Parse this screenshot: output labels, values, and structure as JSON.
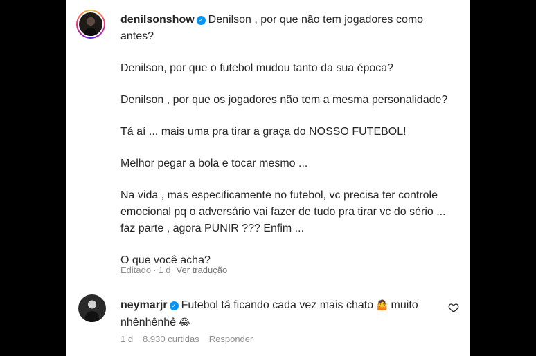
{
  "post": {
    "username": "denilsonshow",
    "paragraphs": [
      "Denilson , por que não tem jogadores como antes?",
      "Denilson, por que o futebol mudou tanto da sua época?",
      "Denilson , por que os jogadores não tem a mesma personalidade?",
      "Tá aí ... mais uma pra tirar a graça do NOSSO FUTEBOL!",
      "Melhor pegar a bola e tocar mesmo ...",
      "Na vida , mas especificamente no futebol, vc precisa ter controle emocional pq o adversário vai fazer de tudo pra tirar vc do sério ... faz parte , agora PUNIR ??? Enfim ...",
      "O que você acha?"
    ],
    "edited_label": "Editado",
    "separator": "·",
    "time_ago": "1 d",
    "translate_label": "Ver tradução"
  },
  "reply": {
    "username": "neymarjr",
    "text_before_emoji": "Futebol tá ficando cada vez mais chato",
    "emoji_1": "🤷",
    "text_after_emoji": "muito nhênhênhê",
    "emoji_2": "😂",
    "time_ago": "1 d",
    "likes": "8.930 curtidas",
    "reply_label": "Responder"
  },
  "icons": {
    "verified": "verified-badge-icon",
    "like": "heart-icon"
  },
  "colors": {
    "verified": "#0095f6",
    "text": "#262626",
    "muted": "#8e8e8e"
  }
}
